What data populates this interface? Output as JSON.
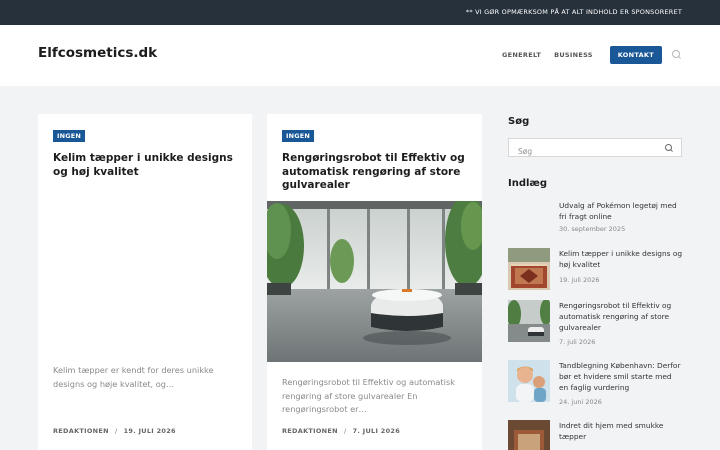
{
  "topbar": {
    "notice": "** VI GØR OPMÆRKSOM PÅ AT ALT INDHOLD ER SPONSORERET"
  },
  "header": {
    "logo": "Elfcosmetics.dk",
    "nav": [
      {
        "label": "GENERELT"
      },
      {
        "label": "BUSINESS"
      }
    ],
    "contact_label": "KONTAKT"
  },
  "posts": [
    {
      "category": "INGEN",
      "title": "Kelim tæpper i unikke designs og høj kvalitet",
      "excerpt": "Kelim tæpper er kendt for deres unikke designs og høje kvalitet, og…",
      "author": "REDAKTIONEN",
      "date": "19. JULI 2026"
    },
    {
      "category": "INGEN",
      "title": "Rengøringsrobot til Effektiv og automatisk rengøring af store gulvarealer",
      "excerpt": "Rengøringsrobot til Effektiv og automatisk rengøring af store gulvarealer En rengøringsrobot er…",
      "author": "REDAKTIONEN",
      "date": "7. JULI 2026"
    }
  ],
  "sidebar": {
    "search_heading": "Søg",
    "search_placeholder": "Søg",
    "posts_heading": "Indlæg",
    "recent": [
      {
        "title": "Udvalg af Pokémon legetøj med fri fragt online",
        "date": "30. september 2025",
        "thumb": "none"
      },
      {
        "title": "Kelim tæpper i unikke designs og høj kvalitet",
        "date": "19. juli 2026",
        "thumb": "rug"
      },
      {
        "title": "Rengøringsrobot til Effektiv og automatisk rengøring af store gulvarealer",
        "date": "7. juli 2026",
        "thumb": "robot"
      },
      {
        "title": "Tandblegning København: Derfor bør et hvidere smil starte med en faglig vurdering",
        "date": "24. juni 2026",
        "thumb": "smile"
      },
      {
        "title": "Indret dit hjem med smukke tæpper",
        "date": "",
        "thumb": "rug2"
      }
    ]
  },
  "colors": {
    "topbar": "#27313c",
    "accent": "#1a5796",
    "background": "#f2f3f5"
  }
}
